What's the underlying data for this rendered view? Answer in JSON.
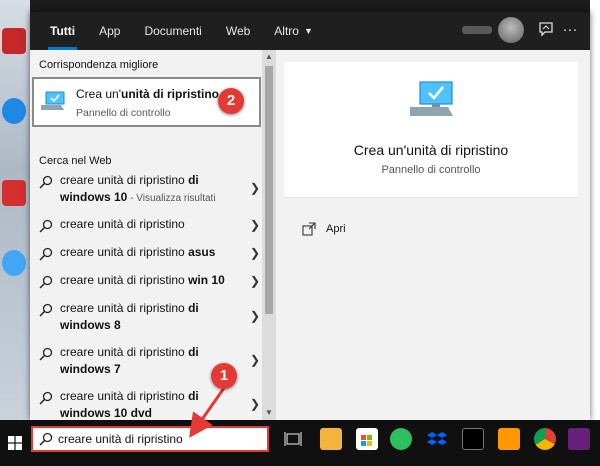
{
  "tabs": [
    {
      "label": "Tutti",
      "active": true
    },
    {
      "label": "App",
      "active": false
    },
    {
      "label": "Documenti",
      "active": false
    },
    {
      "label": "Web",
      "active": false
    },
    {
      "label": "Altro",
      "active": false
    }
  ],
  "best_match": {
    "header": "Corrispondenza migliore",
    "title_prefix": "Crea un'",
    "title_bold": "unità di ripristino",
    "subtitle": "Pannello di controllo"
  },
  "web": {
    "header": "Cerca nel Web",
    "items": [
      {
        "prefix": "creare unità di ripristino ",
        "bold": "di",
        "line2_bold": "windows 10",
        "suffix": " - Visualizza risultati"
      },
      {
        "prefix": "creare unità di ripristino",
        "bold": "",
        "line2_bold": "",
        "suffix": ""
      },
      {
        "prefix": "creare unità di ripristino ",
        "bold": "asus",
        "line2_bold": "",
        "suffix": ""
      },
      {
        "prefix": "creare unità di ripristino ",
        "bold": "win 10",
        "line2_bold": "",
        "suffix": ""
      },
      {
        "prefix": "creare unità di ripristino ",
        "bold": "di",
        "line2_bold": "windows 8",
        "suffix": ""
      },
      {
        "prefix": "creare unità di ripristino ",
        "bold": "di",
        "line2_bold": "windows 7",
        "suffix": ""
      },
      {
        "prefix": "creare unità di ripristino ",
        "bold": "di",
        "line2_bold": "windows 10 dvd",
        "suffix": ""
      }
    ]
  },
  "detail": {
    "title": "Crea un'unità di ripristino",
    "subtitle": "Pannello di controllo",
    "open_label": "Apri"
  },
  "search": {
    "value": "creare unità di ripristino"
  },
  "callouts": {
    "one": "1",
    "two": "2"
  },
  "colors": {
    "accent": "#0078d7",
    "callout_red": "#e53935",
    "tab_bar": "#1f1f1f",
    "taskbar": "#101010"
  }
}
